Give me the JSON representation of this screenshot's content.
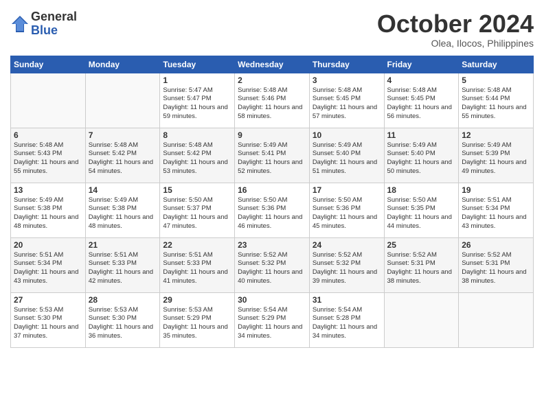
{
  "logo": {
    "general": "General",
    "blue": "Blue"
  },
  "header": {
    "month": "October 2024",
    "location": "Olea, Ilocos, Philippines"
  },
  "weekdays": [
    "Sunday",
    "Monday",
    "Tuesday",
    "Wednesday",
    "Thursday",
    "Friday",
    "Saturday"
  ],
  "weeks": [
    [
      {
        "day": "",
        "empty": true
      },
      {
        "day": "",
        "empty": true
      },
      {
        "day": "1",
        "sunrise": "5:47 AM",
        "sunset": "5:47 PM",
        "daylight": "11 hours and 59 minutes."
      },
      {
        "day": "2",
        "sunrise": "5:48 AM",
        "sunset": "5:46 PM",
        "daylight": "11 hours and 58 minutes."
      },
      {
        "day": "3",
        "sunrise": "5:48 AM",
        "sunset": "5:45 PM",
        "daylight": "11 hours and 57 minutes."
      },
      {
        "day": "4",
        "sunrise": "5:48 AM",
        "sunset": "5:45 PM",
        "daylight": "11 hours and 56 minutes."
      },
      {
        "day": "5",
        "sunrise": "5:48 AM",
        "sunset": "5:44 PM",
        "daylight": "11 hours and 55 minutes."
      }
    ],
    [
      {
        "day": "6",
        "sunrise": "5:48 AM",
        "sunset": "5:43 PM",
        "daylight": "11 hours and 55 minutes."
      },
      {
        "day": "7",
        "sunrise": "5:48 AM",
        "sunset": "5:42 PM",
        "daylight": "11 hours and 54 minutes."
      },
      {
        "day": "8",
        "sunrise": "5:48 AM",
        "sunset": "5:42 PM",
        "daylight": "11 hours and 53 minutes."
      },
      {
        "day": "9",
        "sunrise": "5:49 AM",
        "sunset": "5:41 PM",
        "daylight": "11 hours and 52 minutes."
      },
      {
        "day": "10",
        "sunrise": "5:49 AM",
        "sunset": "5:40 PM",
        "daylight": "11 hours and 51 minutes."
      },
      {
        "day": "11",
        "sunrise": "5:49 AM",
        "sunset": "5:40 PM",
        "daylight": "11 hours and 50 minutes."
      },
      {
        "day": "12",
        "sunrise": "5:49 AM",
        "sunset": "5:39 PM",
        "daylight": "11 hours and 49 minutes."
      }
    ],
    [
      {
        "day": "13",
        "sunrise": "5:49 AM",
        "sunset": "5:38 PM",
        "daylight": "11 hours and 48 minutes."
      },
      {
        "day": "14",
        "sunrise": "5:49 AM",
        "sunset": "5:38 PM",
        "daylight": "11 hours and 48 minutes."
      },
      {
        "day": "15",
        "sunrise": "5:50 AM",
        "sunset": "5:37 PM",
        "daylight": "11 hours and 47 minutes."
      },
      {
        "day": "16",
        "sunrise": "5:50 AM",
        "sunset": "5:36 PM",
        "daylight": "11 hours and 46 minutes."
      },
      {
        "day": "17",
        "sunrise": "5:50 AM",
        "sunset": "5:36 PM",
        "daylight": "11 hours and 45 minutes."
      },
      {
        "day": "18",
        "sunrise": "5:50 AM",
        "sunset": "5:35 PM",
        "daylight": "11 hours and 44 minutes."
      },
      {
        "day": "19",
        "sunrise": "5:51 AM",
        "sunset": "5:34 PM",
        "daylight": "11 hours and 43 minutes."
      }
    ],
    [
      {
        "day": "20",
        "sunrise": "5:51 AM",
        "sunset": "5:34 PM",
        "daylight": "11 hours and 43 minutes."
      },
      {
        "day": "21",
        "sunrise": "5:51 AM",
        "sunset": "5:33 PM",
        "daylight": "11 hours and 42 minutes."
      },
      {
        "day": "22",
        "sunrise": "5:51 AM",
        "sunset": "5:33 PM",
        "daylight": "11 hours and 41 minutes."
      },
      {
        "day": "23",
        "sunrise": "5:52 AM",
        "sunset": "5:32 PM",
        "daylight": "11 hours and 40 minutes."
      },
      {
        "day": "24",
        "sunrise": "5:52 AM",
        "sunset": "5:32 PM",
        "daylight": "11 hours and 39 minutes."
      },
      {
        "day": "25",
        "sunrise": "5:52 AM",
        "sunset": "5:31 PM",
        "daylight": "11 hours and 38 minutes."
      },
      {
        "day": "26",
        "sunrise": "5:52 AM",
        "sunset": "5:31 PM",
        "daylight": "11 hours and 38 minutes."
      }
    ],
    [
      {
        "day": "27",
        "sunrise": "5:53 AM",
        "sunset": "5:30 PM",
        "daylight": "11 hours and 37 minutes."
      },
      {
        "day": "28",
        "sunrise": "5:53 AM",
        "sunset": "5:30 PM",
        "daylight": "11 hours and 36 minutes."
      },
      {
        "day": "29",
        "sunrise": "5:53 AM",
        "sunset": "5:29 PM",
        "daylight": "11 hours and 35 minutes."
      },
      {
        "day": "30",
        "sunrise": "5:54 AM",
        "sunset": "5:29 PM",
        "daylight": "11 hours and 34 minutes."
      },
      {
        "day": "31",
        "sunrise": "5:54 AM",
        "sunset": "5:28 PM",
        "daylight": "11 hours and 34 minutes."
      },
      {
        "day": "",
        "empty": true
      },
      {
        "day": "",
        "empty": true
      }
    ]
  ]
}
